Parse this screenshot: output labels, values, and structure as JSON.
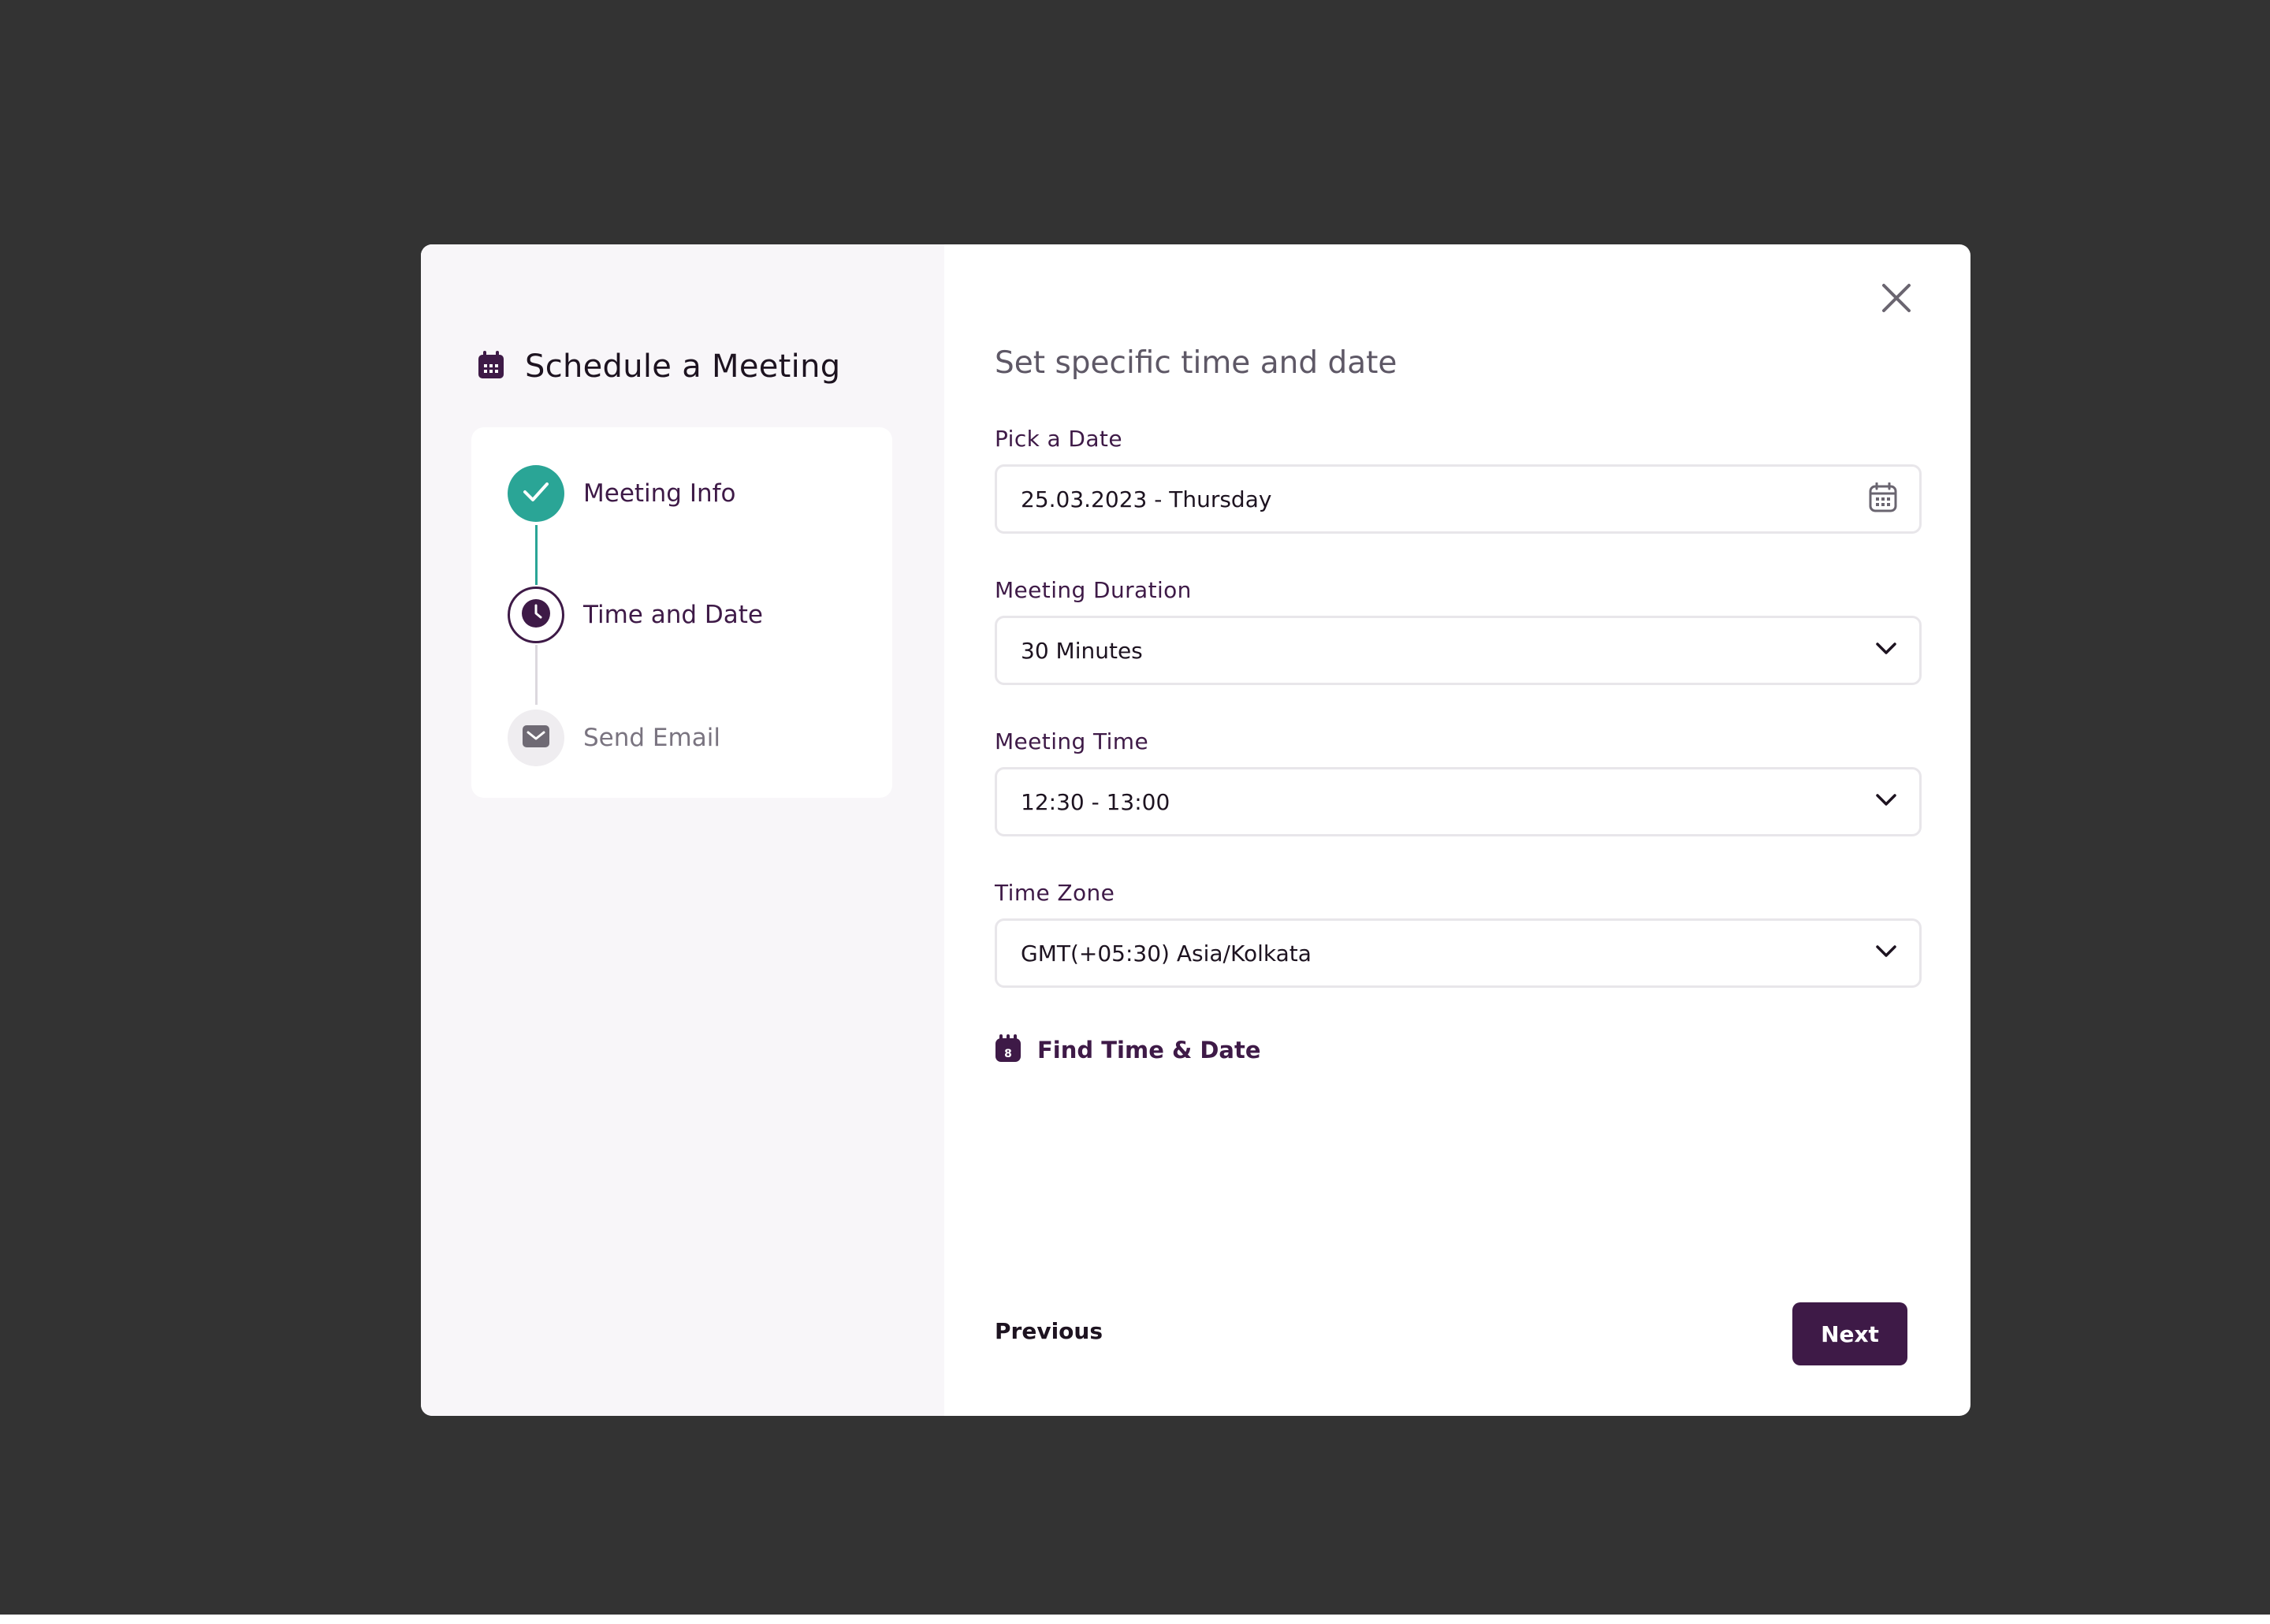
{
  "sidebar": {
    "title": "Schedule a Meeting",
    "steps": [
      {
        "label": "Meeting Info",
        "status": "completed"
      },
      {
        "label": "Time and Date",
        "status": "current"
      },
      {
        "label": "Send Email",
        "status": "pending"
      }
    ]
  },
  "main": {
    "title": "Set specific time and date",
    "fields": {
      "date": {
        "label": "Pick a Date",
        "value": "25.03.2023 - Thursday",
        "icon": "calendar-icon"
      },
      "duration": {
        "label": "Meeting Duration",
        "value": "30 Minutes",
        "icon": "chevron-down-icon"
      },
      "time": {
        "label": "Meeting Time",
        "value": "12:30 - 13:00",
        "icon": "chevron-down-icon"
      },
      "timezone": {
        "label": "Time Zone",
        "value": "GMT(+05:30) Asia/Kolkata",
        "icon": "chevron-down-icon"
      }
    },
    "find_link": {
      "label": "Find Time & Date",
      "icon_digit": "8"
    },
    "buttons": {
      "previous": "Previous",
      "next": "Next"
    }
  },
  "colors": {
    "backdrop": "#333333",
    "brand": "#3e1a47",
    "success": "#2aa596",
    "sidebar_bg": "#f8f6f9"
  }
}
